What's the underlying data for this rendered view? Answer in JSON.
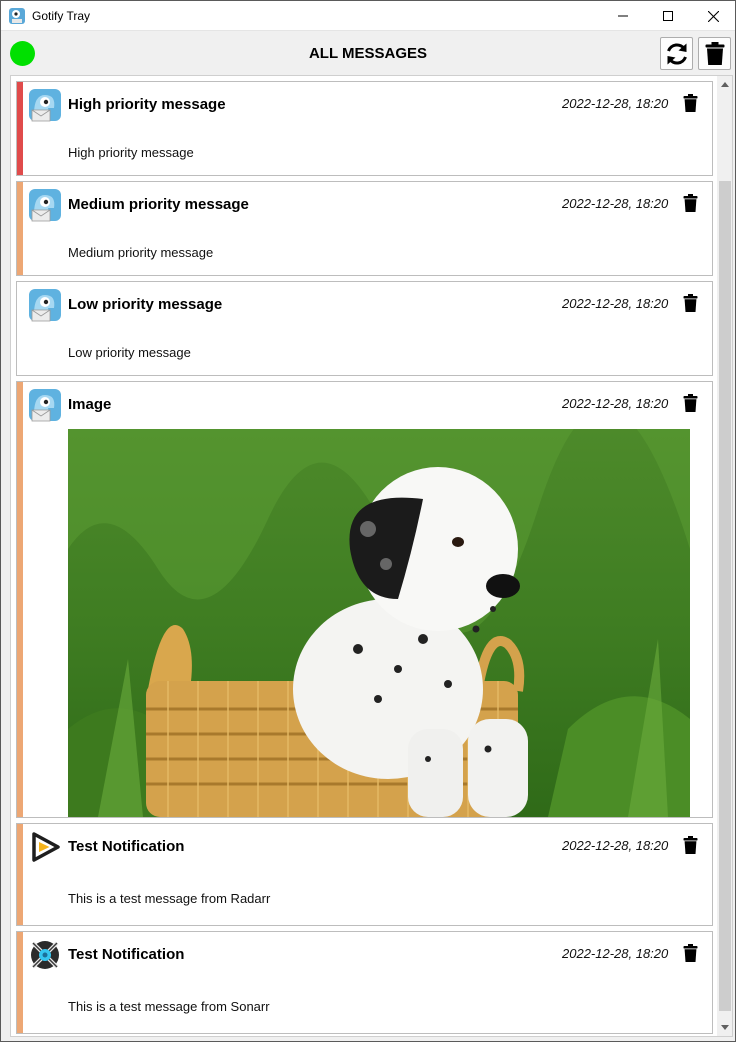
{
  "window": {
    "title": "Gotify Tray",
    "minimize_icon": "minimize-icon",
    "maximize_icon": "maximize-icon",
    "close_icon": "close-icon"
  },
  "header": {
    "title": "ALL MESSAGES",
    "status": "connected",
    "status_color": "#00e000",
    "refresh_icon": "refresh-icon",
    "delete_all_icon": "trash-icon"
  },
  "messages": [
    {
      "title": "High priority message",
      "date": "2022-12-28, 18:20",
      "body": "High priority message",
      "priority_color": "#e04b4b",
      "app_icon": "gotify-icon"
    },
    {
      "title": "Medium priority message",
      "date": "2022-12-28, 18:20",
      "body": "Medium priority message",
      "priority_color": "#eda774",
      "app_icon": "gotify-icon"
    },
    {
      "title": "Low priority message",
      "date": "2022-12-28, 18:20",
      "body": "Low priority message",
      "priority_color": "#ffffff",
      "app_icon": "gotify-icon"
    },
    {
      "title": "Image",
      "date": "2022-12-28, 18:20",
      "body": "",
      "priority_color": "#eda774",
      "app_icon": "gotify-icon",
      "image": "dalmatian-puppy-in-basket"
    },
    {
      "title": "Test Notification",
      "date": "2022-12-28, 18:20",
      "body": "This is a test message from Radarr",
      "priority_color": "#eda774",
      "app_icon": "radarr-icon"
    },
    {
      "title": "Test Notification",
      "date": "2022-12-28, 18:20",
      "body": "This is a test message from Sonarr",
      "priority_color": "#eda774",
      "app_icon": "sonarr-icon"
    }
  ]
}
